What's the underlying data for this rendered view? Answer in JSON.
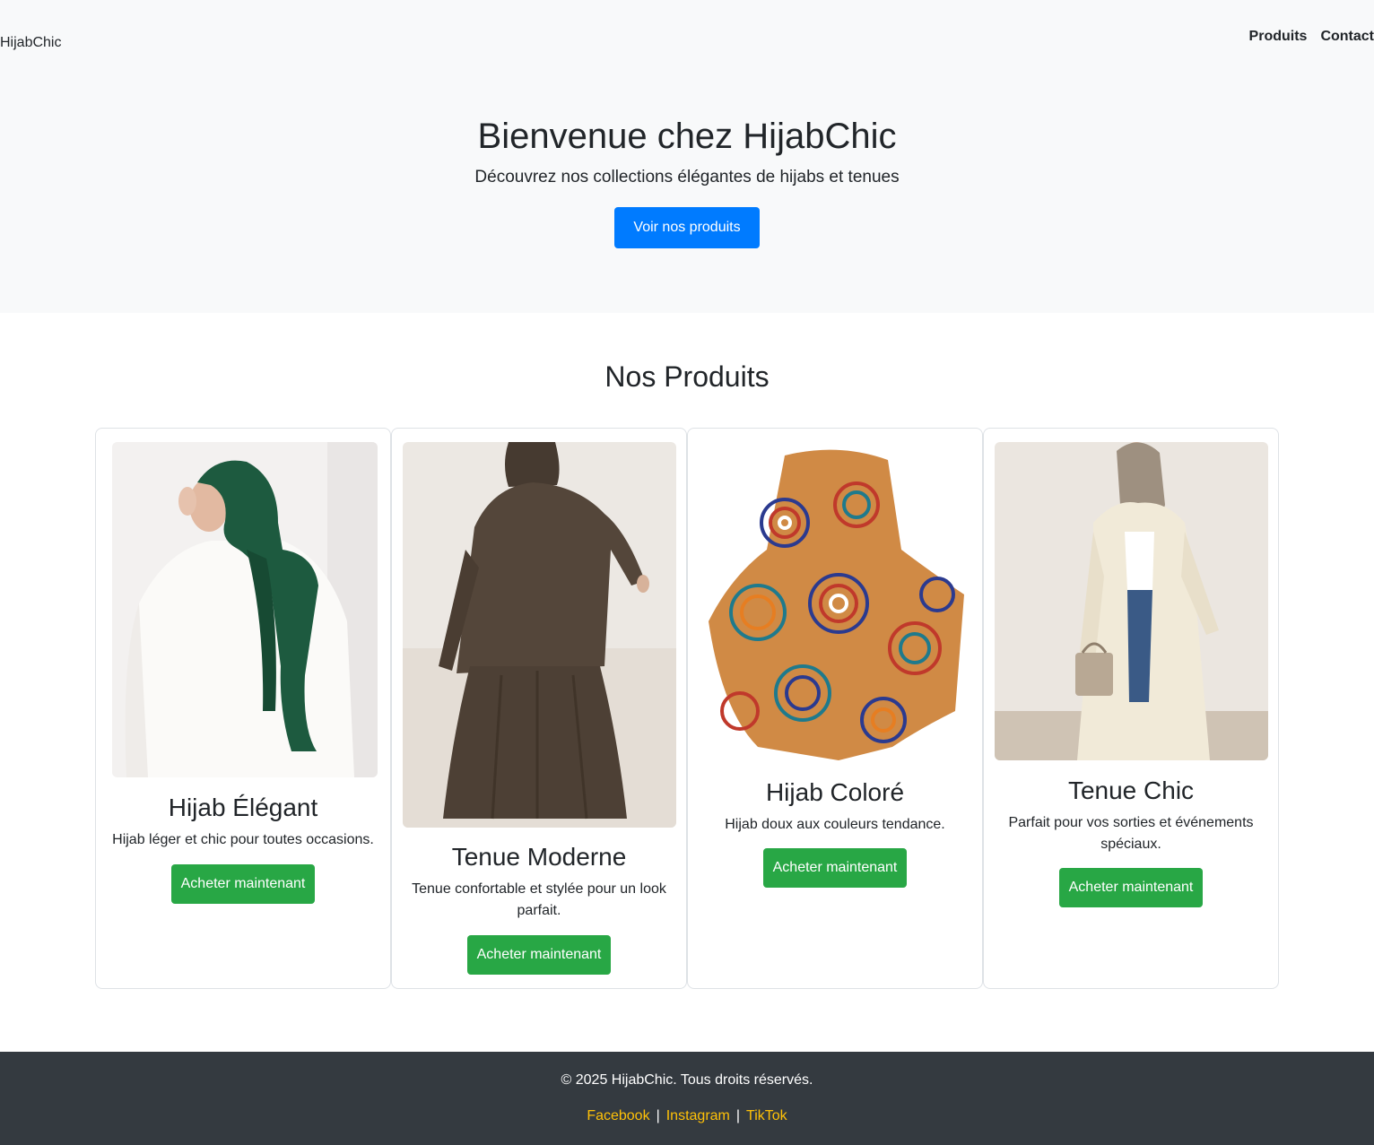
{
  "header": {
    "brand": "HijabChic",
    "nav": [
      "Produits",
      "Contact"
    ]
  },
  "hero": {
    "title": "Bienvenue chez HijabChic",
    "subtitle": "Découvrez nos collections élégantes de hijabs et tenues",
    "cta": "Voir nos produits"
  },
  "products": {
    "title": "Nos Produits",
    "items": [
      {
        "name": "Hijab Élégant",
        "description": "Hijab léger et chic pour toutes occasions.",
        "button": "Acheter maintenant"
      },
      {
        "name": "Tenue Moderne",
        "description": "Tenue confortable et stylée pour un look parfait.",
        "button": "Acheter maintenant"
      },
      {
        "name": "Hijab Coloré",
        "description": "Hijab doux aux couleurs tendance.",
        "button": "Acheter maintenant"
      },
      {
        "name": "Tenue Chic",
        "description": "Parfait pour vos sorties et événements spéciaux.",
        "button": "Acheter maintenant"
      }
    ]
  },
  "footer": {
    "copyright": "© 2025 HijabChic. Tous droits réservés.",
    "social": [
      "Facebook",
      "Instagram",
      "TikTok"
    ],
    "separator": "|"
  },
  "colors": {
    "primary": "#007bff",
    "success": "#28a745",
    "footer_bg": "#343a40",
    "link": "#ffc107",
    "light_bg": "#f8f9fa"
  }
}
